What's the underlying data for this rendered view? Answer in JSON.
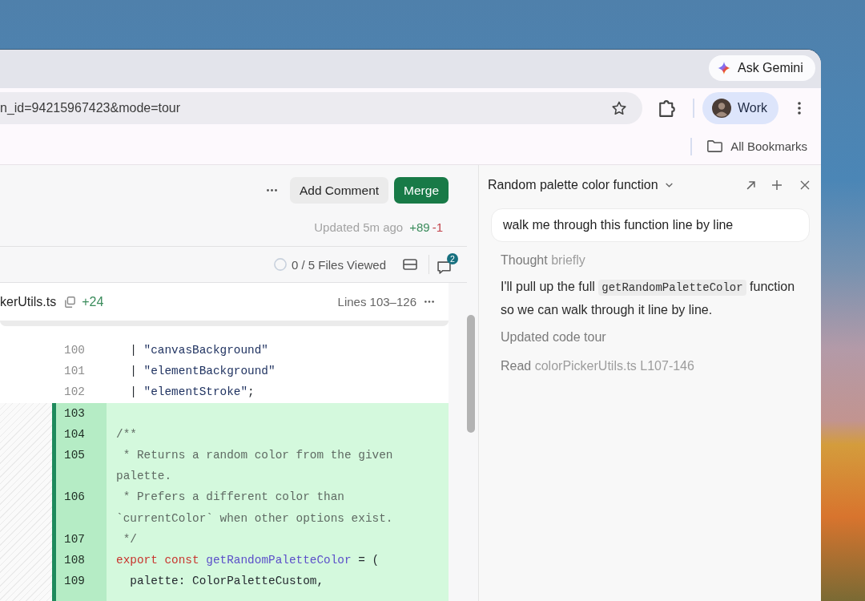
{
  "browser": {
    "ask_button": {
      "label": "Ask Gemini"
    },
    "address_bar": {
      "url": "n_id=94215967423&mode=tour"
    },
    "profile": {
      "label": "Work"
    },
    "bookmarks": [
      {
        "label": "All Bookmarks"
      }
    ]
  },
  "review": {
    "actions": [
      {
        "label": "Add Comment",
        "kind": "secondary"
      },
      {
        "label": "Merge",
        "kind": "primary"
      }
    ],
    "status": {
      "updated": "Updated 5m ago",
      "additions": "+89",
      "deletions": "-1"
    },
    "files_viewed": "0 / 5 Files Viewed",
    "comment_count": "2",
    "file": {
      "name": "kerUtils.ts",
      "additions": "+24",
      "range": "Lines 103–126",
      "lines": [
        {
          "number": "100",
          "added": false,
          "tokens": [
            {
              "kind": "plain",
              "text": "  | "
            },
            {
              "kind": "str",
              "text": "\"canvasBackground\""
            }
          ]
        },
        {
          "number": "101",
          "added": false,
          "tokens": [
            {
              "kind": "plain",
              "text": "  | "
            },
            {
              "kind": "str",
              "text": "\"elementBackground\""
            }
          ]
        },
        {
          "number": "102",
          "added": false,
          "tokens": [
            {
              "kind": "plain",
              "text": "  | "
            },
            {
              "kind": "str",
              "text": "\"elementStroke\""
            },
            {
              "kind": "plain",
              "text": ";"
            }
          ]
        },
        {
          "number": "103",
          "added": true
        },
        {
          "number": "104",
          "added": true,
          "tokens": [
            {
              "kind": "comment",
              "text": "/**"
            }
          ]
        },
        {
          "number": "105",
          "added": true,
          "tokens": [
            {
              "kind": "comment",
              "text": " * Returns a random color from the given palette."
            }
          ]
        },
        {
          "number": "106",
          "added": true,
          "tokens": [
            {
              "kind": "comment",
              "text": " * Prefers a different color than `currentColor` when other options exist."
            }
          ]
        },
        {
          "number": "107",
          "added": true,
          "tokens": [
            {
              "kind": "comment",
              "text": " */"
            }
          ]
        },
        {
          "number": "108",
          "added": true,
          "tokens": [
            {
              "kind": "kw",
              "text": "export"
            },
            {
              "kind": "kw",
              "text": " const"
            },
            {
              "kind": "fn",
              "text": " getRandomPaletteColor"
            },
            {
              "kind": "plain",
              "text": " = ("
            }
          ]
        },
        {
          "number": "109",
          "added": true,
          "tokens": [
            {
              "kind": "plain",
              "text": "  palette: ColorPaletteCustom,"
            }
          ]
        }
      ]
    }
  },
  "panel": {
    "title": "Random palette color function",
    "messages": [
      {
        "kind": "user",
        "text": "walk me through this function line by line"
      },
      {
        "kind": "status",
        "lead": "Thought",
        "rest": "briefly"
      },
      {
        "kind": "assistant",
        "parts": [
          {
            "kind": "text",
            "text": "I'll pull up the full "
          },
          {
            "kind": "code",
            "text": "getRandomPaletteColor"
          },
          {
            "kind": "text",
            "text": " function so we can walk through it line by line."
          }
        ]
      },
      {
        "kind": "status",
        "lead": "Updated code tour"
      },
      {
        "kind": "status",
        "lead": "Read",
        "rest": "colorPickerUtils.ts L107-146"
      }
    ]
  }
}
